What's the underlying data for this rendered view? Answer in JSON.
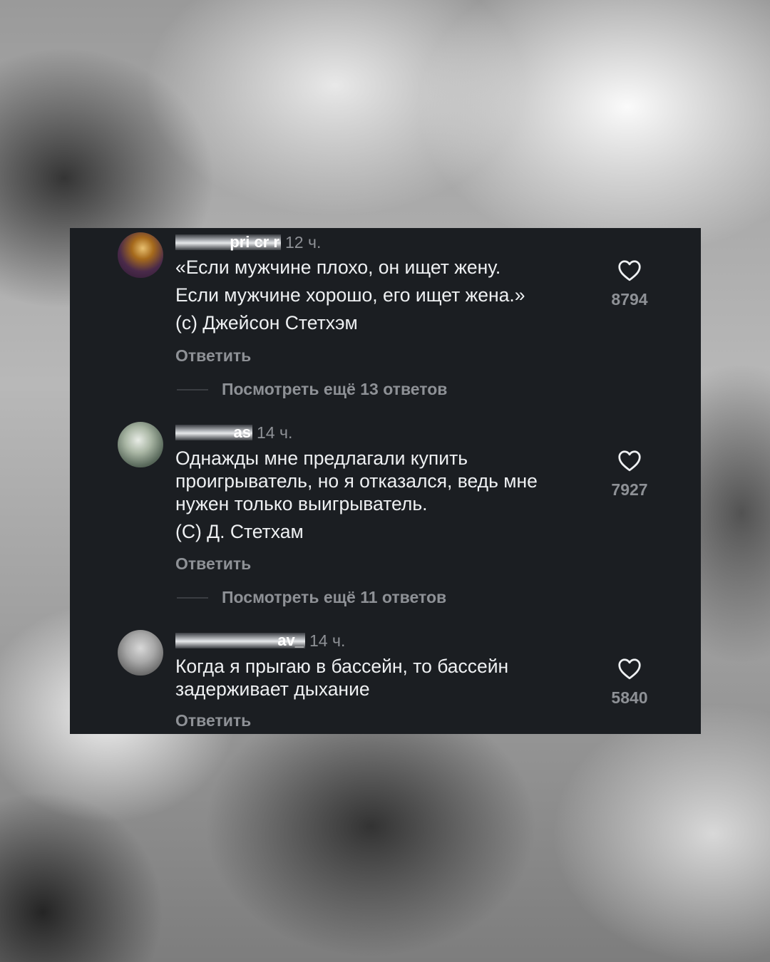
{
  "comments": [
    {
      "username": "pri cr r",
      "time": "12 ч.",
      "lines": [
        "«Если мужчине плохо, он ищет жену.",
        "Если мужчине хорошо, его ищет жена.»",
        "(с) Джейсон Стетхэм"
      ],
      "reply_label": "Ответить",
      "more_replies_label": "Посмотреть ещё 13 ответов",
      "likes": "8794",
      "avatar_icon": "avatar-gold-mask"
    },
    {
      "username": "as",
      "time": "14 ч.",
      "lines": [
        "Однажды мне предлагали купить",
        "проигрыватель, но я отказался, ведь мне",
        "нужен только выигрыватель.",
        "(С) Д. Стетхам"
      ],
      "reply_label": "Ответить",
      "more_replies_label": "Посмотреть ещё 11 ответов",
      "likes": "7927",
      "avatar_icon": "avatar-green-photo"
    },
    {
      "username": "av_",
      "time": "14 ч.",
      "lines": [
        "Когда я прыгаю в бассейн, то бассейн",
        "задерживает дыхание"
      ],
      "reply_label": "Ответить",
      "likes": "5840",
      "avatar_icon": "avatar-grey-photo"
    }
  ],
  "colors": {
    "panel_bg": "#1b1e22",
    "text": "#eef0f2",
    "muted": "#8e9196"
  }
}
